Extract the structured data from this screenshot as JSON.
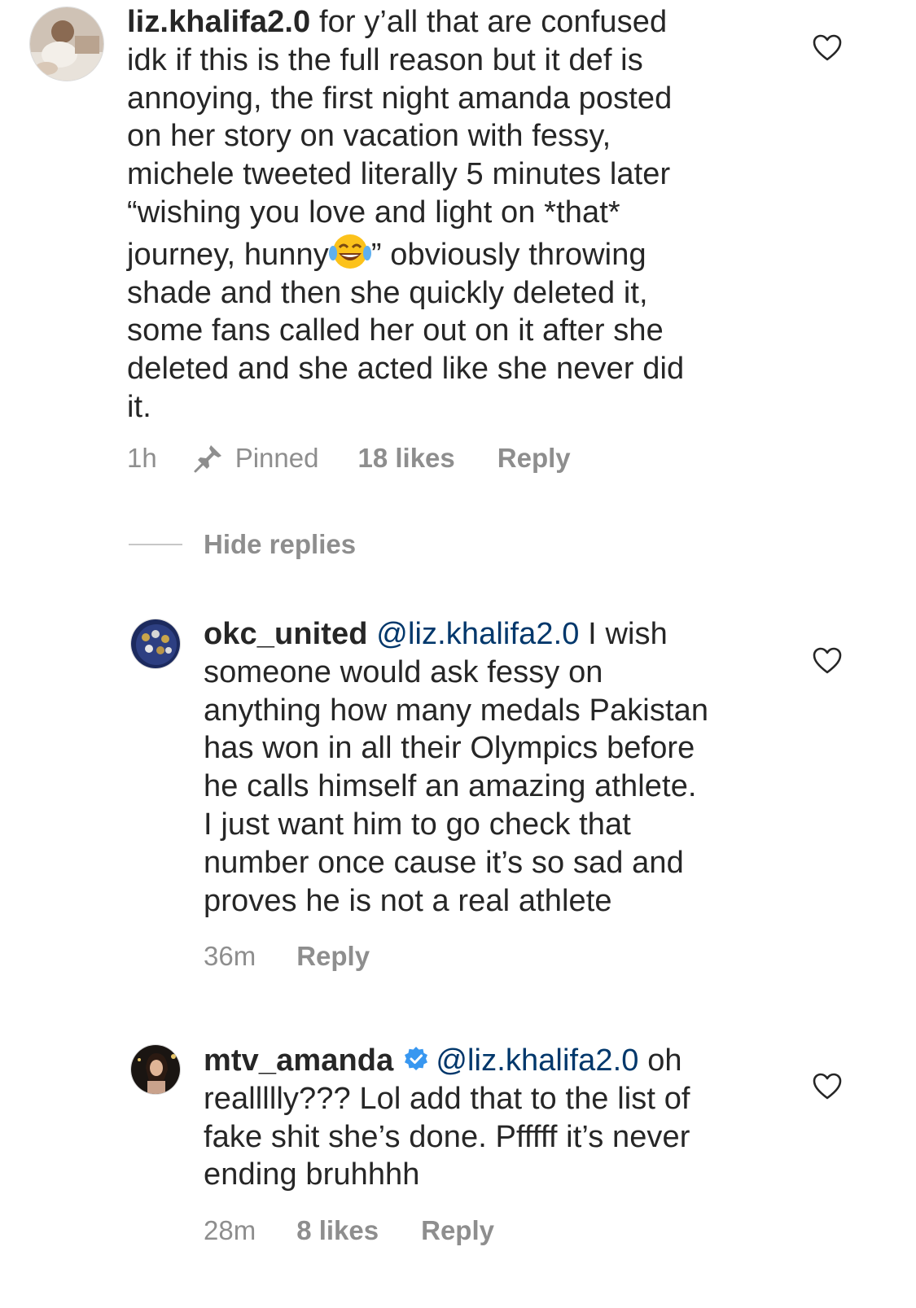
{
  "comments": [
    {
      "username": "liz.khalifa2.0",
      "lines": [
        "for y’all that are confused",
        "idk if this is the full reason but it def is",
        "annoying, the first night amanda posted",
        "on her story on vacation with fessy,",
        "michele tweeted literally 5 minutes later",
        "“wishing you love and light on *that*",
        "journey, hunny",
        "” obviously throwing",
        "shade and then she quickly deleted it,",
        "some fans called her out on it after she",
        "deleted and she acted like she never did",
        "it."
      ],
      "time": "1h",
      "pinned_label": "Pinned",
      "likes": "18 likes",
      "reply_label": "Reply"
    },
    {
      "username": "okc_united",
      "mention": "@liz.khalifa2.0",
      "lines": [
        "I wish",
        "someone would ask fessy on",
        "anything how many medals Pakistan",
        "has won in all their Olympics before",
        "he calls himself an amazing athlete.",
        "I just want him to go check that",
        "number once cause it’s so sad and",
        "proves he is not a real athlete"
      ],
      "time": "36m",
      "reply_label": "Reply"
    },
    {
      "username": "mtv_amanda",
      "mention": "@liz.khalifa2.0",
      "lines": [
        "oh",
        "reallllly??? Lol add that to the list of",
        "fake shit she’s done. Pfffff it’s never",
        "ending bruhhhh"
      ],
      "time": "28m",
      "likes": "8 likes",
      "reply_label": "Reply"
    }
  ],
  "hide_replies_label": "Hide replies",
  "icons": {
    "like": "heart-outline-icon",
    "pin": "pushpin-icon",
    "emoji": "face-with-tears-of-joy-emoji",
    "verified": "verified-badge-icon"
  },
  "colors": {
    "text": "#262626",
    "meta": "#8e8e8e",
    "mention": "#00376b",
    "verified": "#3897f0"
  }
}
